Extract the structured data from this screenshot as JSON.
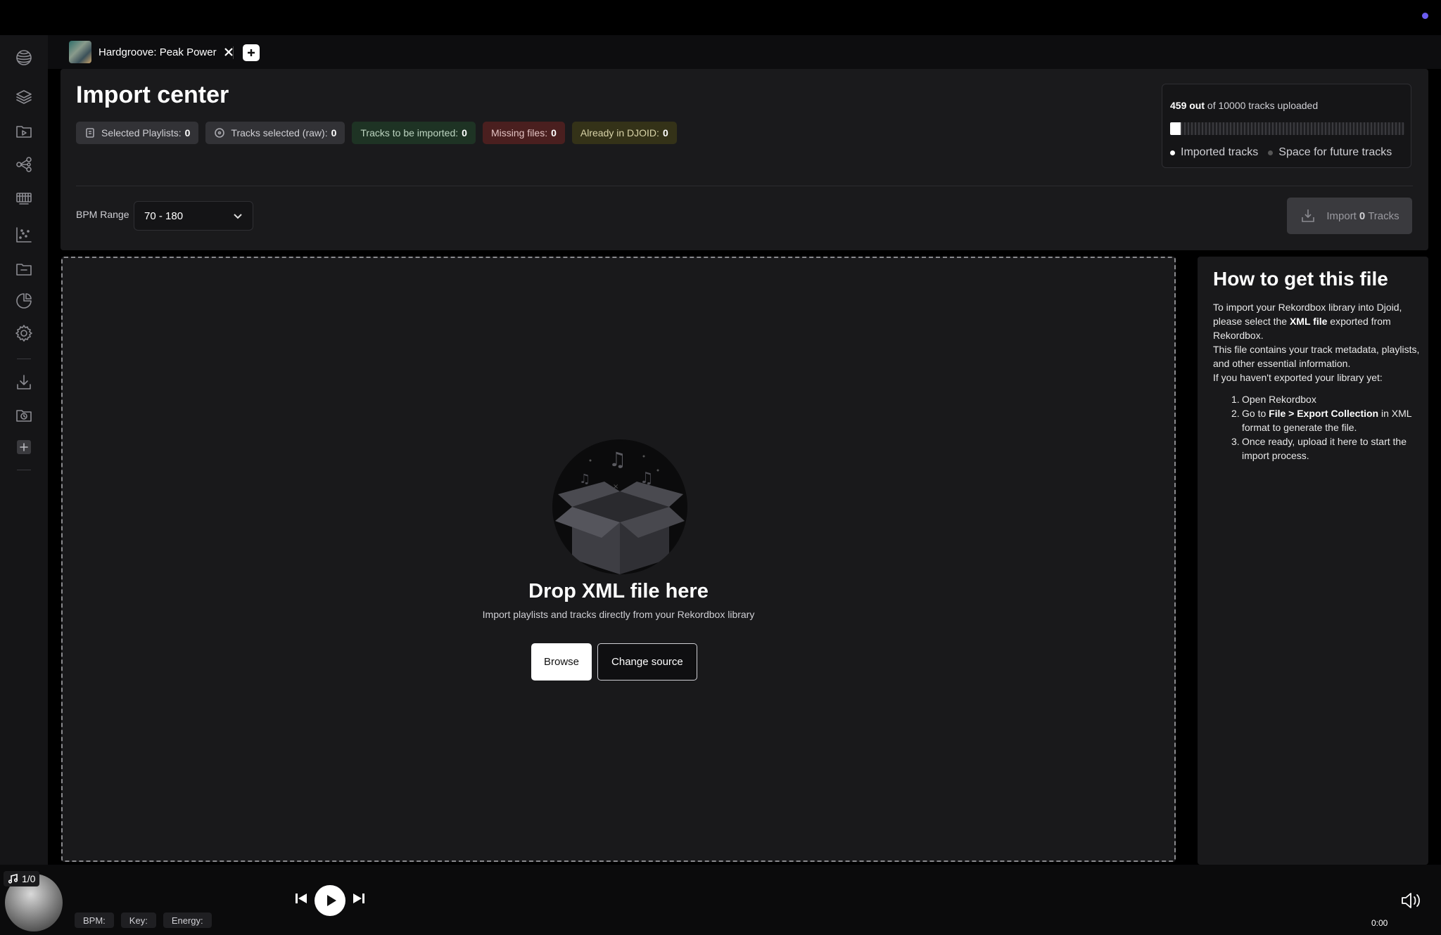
{
  "tab": {
    "title": "Hardgroove: Peak Power"
  },
  "page": {
    "title": "Import center"
  },
  "chips": [
    {
      "label": "Selected Playlists:",
      "value": "0"
    },
    {
      "label": "Tracks selected (raw):",
      "value": "0"
    },
    {
      "label": "Tracks to be imported:",
      "value": "0"
    },
    {
      "label": "Missing files:",
      "value": "0"
    },
    {
      "label": "Already in DJOID:",
      "value": "0"
    }
  ],
  "upload": {
    "count_bold": "459 out",
    "rest": "of 10000 tracks uploaded",
    "progress_fraction": 0.0459,
    "legend_imported": "Imported tracks",
    "legend_space": "Space for future tracks"
  },
  "filters": {
    "bpm_label": "BPM Range",
    "bpm_value": "70 - 180"
  },
  "import_button": {
    "prefix": "Import",
    "count": "0",
    "suffix": "Tracks"
  },
  "dropzone": {
    "title": "Drop XML file here",
    "subtitle": "Import playlists and tracks directly from your Rekordbox library",
    "browse_label": "Browse",
    "change_label": "Change source"
  },
  "help": {
    "title": "How to get this file",
    "p1_a": "To import your Rekordbox library into Djoid, please select the ",
    "p1_bold": "XML file",
    "p1_b": " exported from Rekordbox.",
    "p2": "This file contains your track metadata, playlists, and other essential information.",
    "p3": "If you haven't exported your library yet:",
    "steps": [
      {
        "num": "1.",
        "text": "Open Rekordbox"
      },
      {
        "num": "2.",
        "pre": "Go to ",
        "bold": "File > Export Collection",
        "post": " in XML format to generate the file."
      },
      {
        "num": "3.",
        "text": "Once ready, upload it here to start the import process."
      }
    ]
  },
  "player": {
    "queue_count": "1/0",
    "bpm_label": "BPM:",
    "key_label": "Key:",
    "energy_label": "Energy:",
    "time": "0:00"
  },
  "colors": {
    "accent": "#6b5cf0",
    "chip_green": "#1e3324",
    "chip_red": "#4a1f1f",
    "chip_olive": "#343218"
  }
}
